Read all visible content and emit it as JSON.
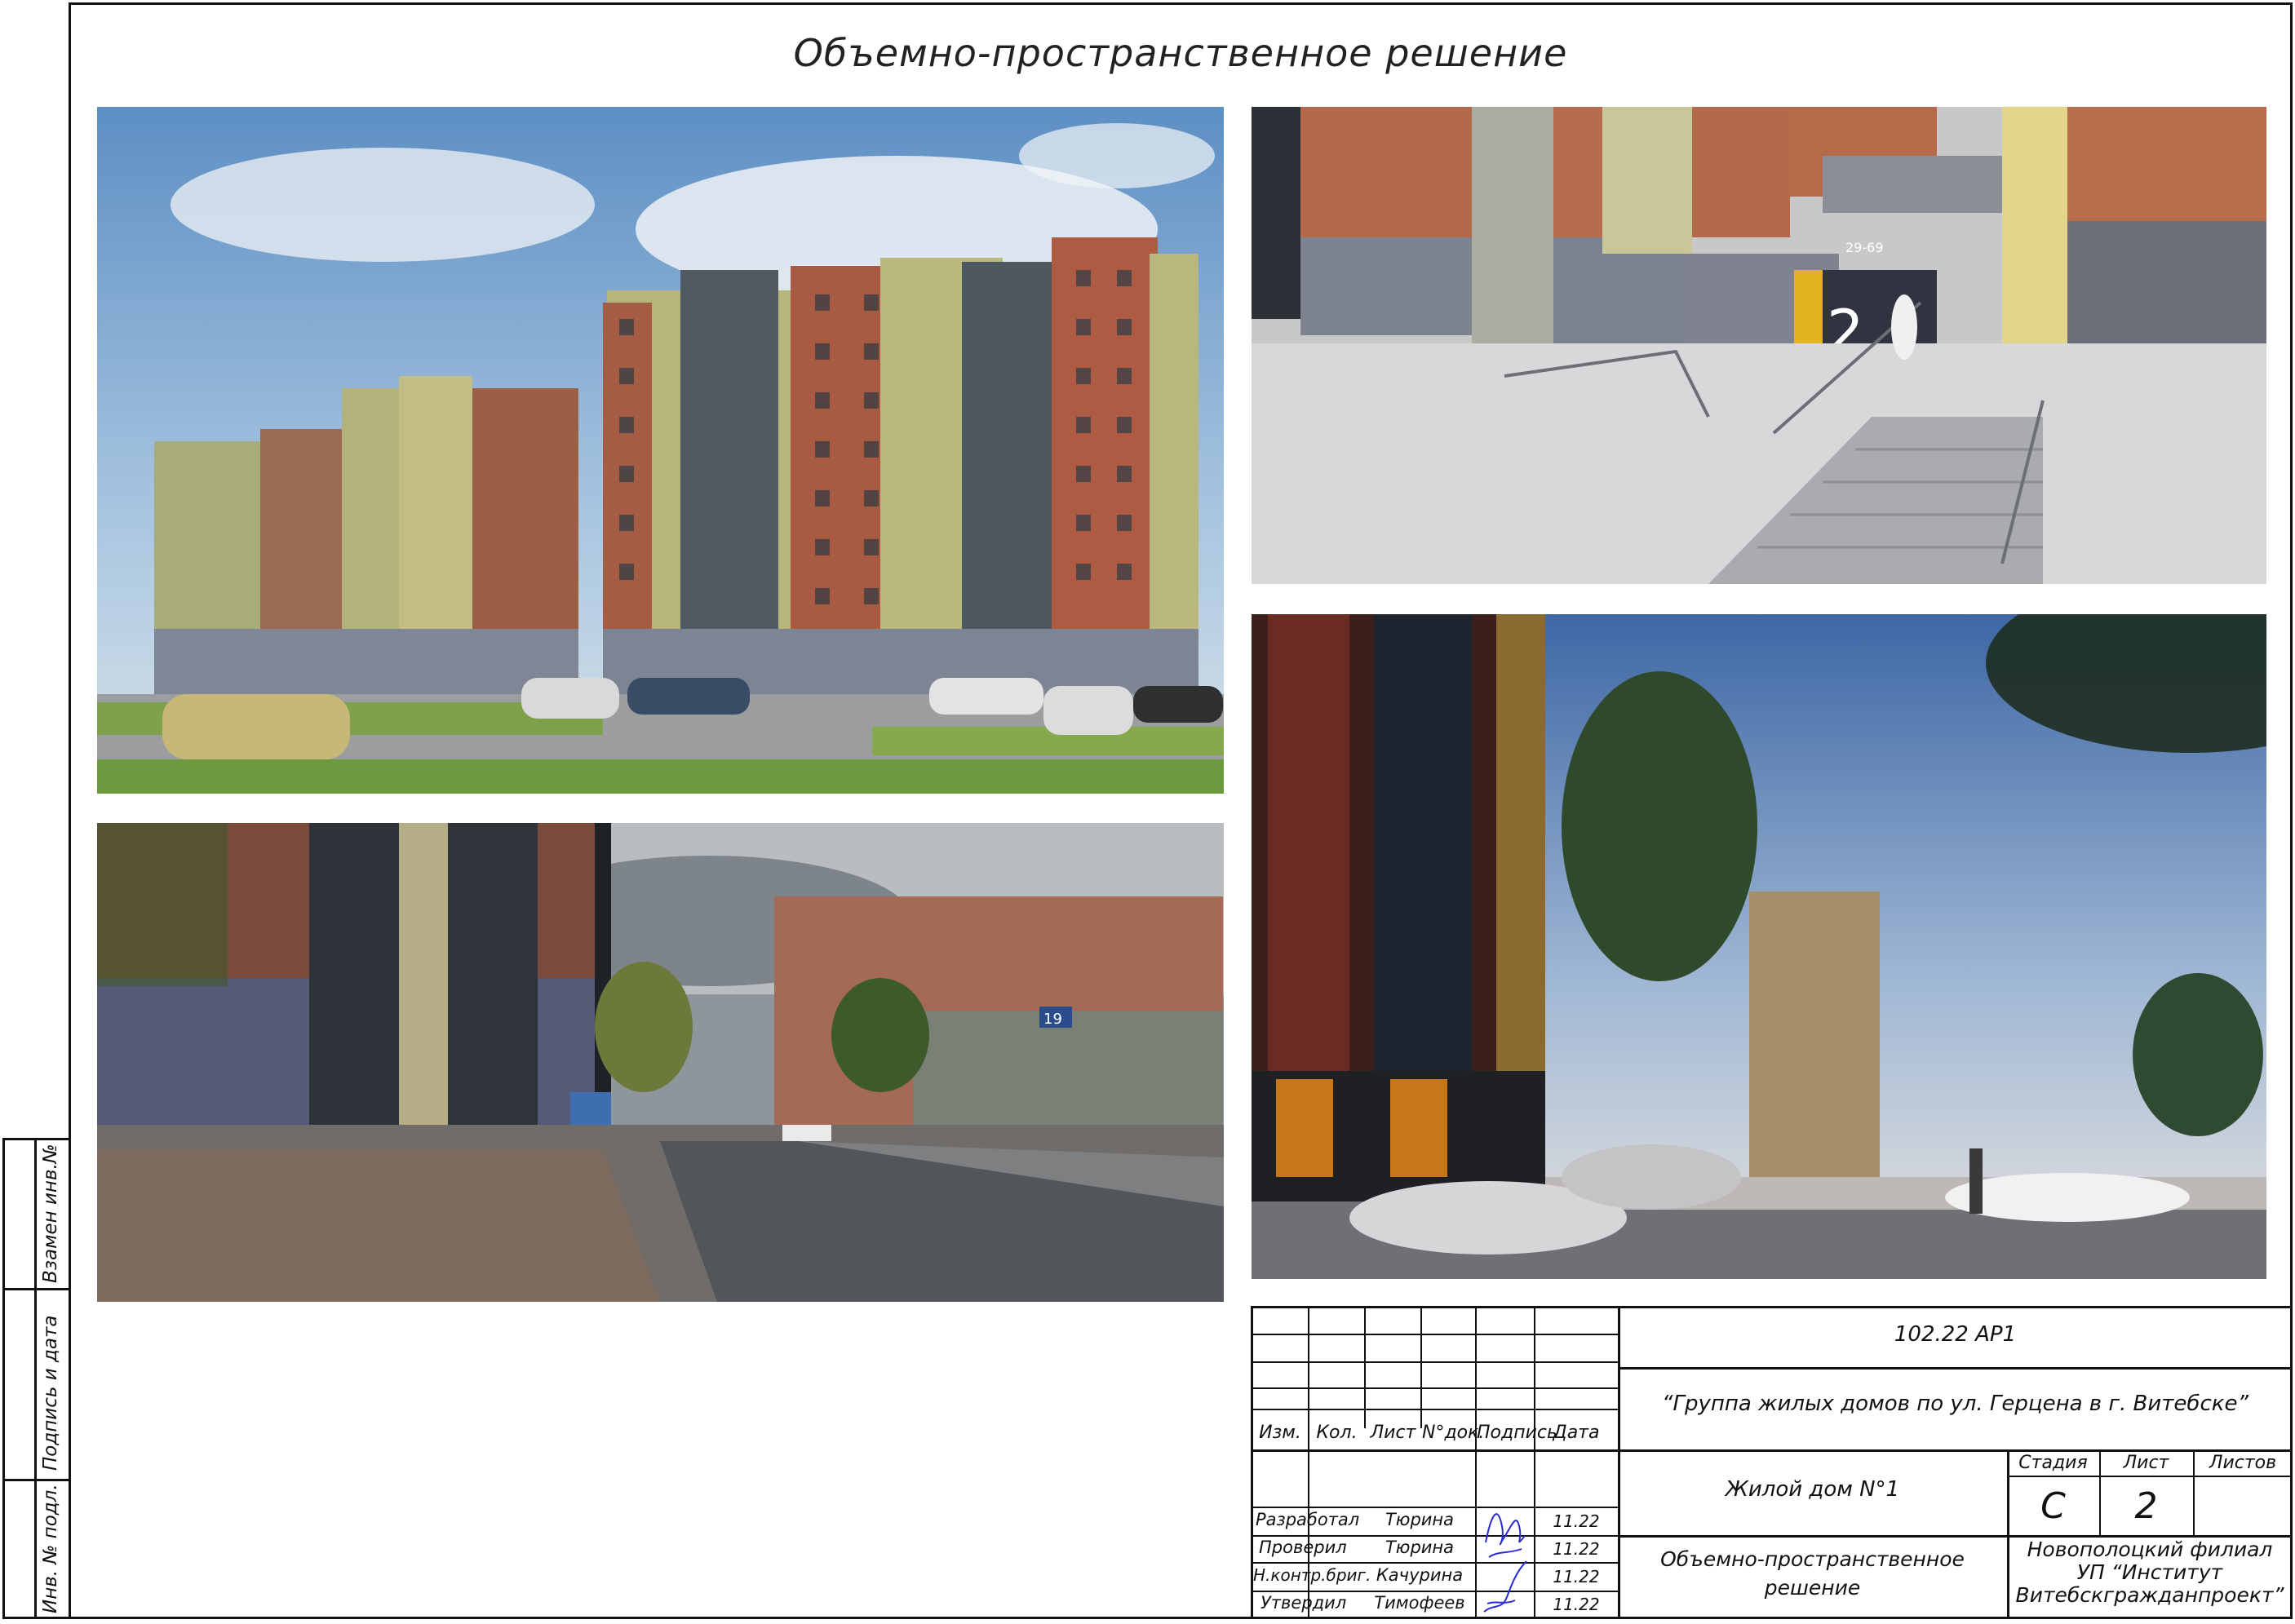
{
  "sheet_title": "Объемно-пространственное решение",
  "photos": {
    "top_left": "render-building-overview",
    "top_right": "render-entrance-ramp",
    "bottom_left": "street-view-photo",
    "bottom_right": "render-evening-street"
  },
  "photo_text": {
    "entrance_range": "29-69",
    "entrance_number": "2",
    "house_number": "19"
  },
  "side_stamp": {
    "inv_replace": "Взамен инв.№",
    "sign_date": "Подпись и дата",
    "inv_orig": "Инв. № подл."
  },
  "title_block": {
    "doc_code": "102.22 АР1",
    "project_name": "“Группа жилых домов по ул. Герцена в г. Витебске”",
    "headers": {
      "izm": "Изм.",
      "kol": "Кол.",
      "list": "Лист",
      "ndok": "N°док.",
      "podpis": "Подпись",
      "data": "Дата"
    },
    "people": [
      {
        "role": "Разработал",
        "name": "Тюрина",
        "date": "11.22"
      },
      {
        "role": "Проверил",
        "name": "Тюрина",
        "date": "11.22"
      },
      {
        "role": "Н.контр.бриг.",
        "name": "Качурина",
        "date": "11.22"
      },
      {
        "role": "Утвердил",
        "name": "Тимофеев",
        "date": "11.22"
      }
    ],
    "building": "Жилой дом N°1",
    "sheet_content_1": "Объемно-пространственное",
    "sheet_content_2": "решение",
    "stage_label": "Стадия",
    "sheet_label": "Лист",
    "sheets_label": "Листов",
    "stage_value": "С",
    "sheet_value": "2",
    "org_1": "Новополоцкий филиал",
    "org_2": "УП “Институт",
    "org_3": "Витебскгражданпроект”"
  },
  "colors": {
    "line": "#111111",
    "signature_ink": "#2b2bd6"
  }
}
